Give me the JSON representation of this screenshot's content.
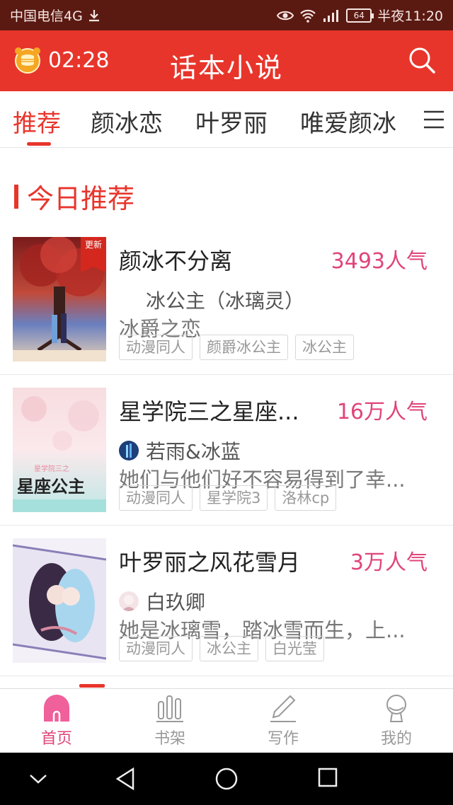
{
  "status_bar": {
    "carrier": "中国电信4G",
    "battery": "64",
    "time": "半夜11:20"
  },
  "header": {
    "timer": "02:28",
    "title": "话本小说"
  },
  "tabs": [
    {
      "label": "推荐",
      "active": true
    },
    {
      "label": "颜冰恋",
      "active": false
    },
    {
      "label": "叶罗丽",
      "active": false
    },
    {
      "label": "唯爱颜冰",
      "active": false
    }
  ],
  "section": {
    "title": "今日推荐"
  },
  "books": [
    {
      "title": "颜冰不分离",
      "popularity": "3493人气",
      "badge": "更新",
      "author": "冰公主（冰璃灵）",
      "description": "冰爵之恋",
      "tags": [
        "动漫同人",
        "颜爵冰公主",
        "冰公主"
      ]
    },
    {
      "title": "星学院三之星座...",
      "popularity": "16万人气",
      "author": "若雨&冰蓝",
      "description": "她们与他们好不容易得到了幸...",
      "tags": [
        "动漫同人",
        "星学院3",
        "洛林cp"
      ]
    },
    {
      "title": "叶罗丽之风花雪月",
      "popularity": "3万人气",
      "author": "白玖卿",
      "description": "她是冰璃雪，踏冰雪而生，上...",
      "tags": [
        "动漫同人",
        "冰公主",
        "白光莹"
      ]
    }
  ],
  "bottom_nav": [
    {
      "label": "首页",
      "icon": "home-icon",
      "active": true
    },
    {
      "label": "书架",
      "icon": "bookshelf-icon",
      "active": false
    },
    {
      "label": "写作",
      "icon": "pen-icon",
      "active": false
    },
    {
      "label": "我的",
      "icon": "profile-icon",
      "active": false
    }
  ],
  "colors": {
    "primary": "#e8352b",
    "popularity": "#e0457b"
  }
}
